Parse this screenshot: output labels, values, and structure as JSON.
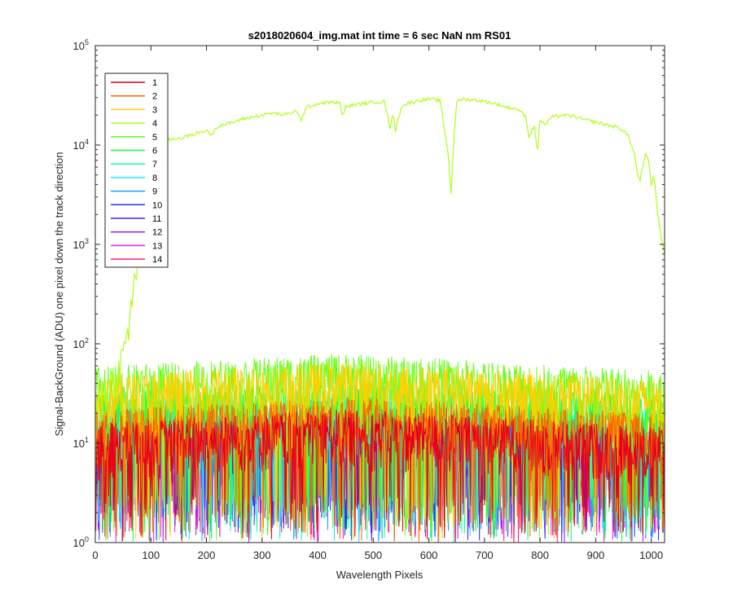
{
  "chart_data": {
    "type": "line",
    "title": "s2018020604_img.mat int time = 6 sec  NaN nm RS01",
    "xlabel": "Wavelength Pixels",
    "ylabel": "Signal-BackGround (ADU) one pixel down the track direction",
    "xlim": [
      0,
      1024
    ],
    "ylim": [
      1,
      100000
    ],
    "yscale": "log",
    "xticks": [
      "0",
      "100",
      "200",
      "300",
      "400",
      "500",
      "600",
      "700",
      "800",
      "900",
      "1000"
    ],
    "yticks": [
      {
        "base": "10",
        "exp": "0"
      },
      {
        "base": "10",
        "exp": "1"
      },
      {
        "base": "10",
        "exp": "2"
      },
      {
        "base": "10",
        "exp": "3"
      },
      {
        "base": "10",
        "exp": "4"
      },
      {
        "base": "10",
        "exp": "5"
      }
    ],
    "legend_position": "top-left",
    "series": [
      {
        "name": "1",
        "color": "#e6001a",
        "level": "noise",
        "typical": 15
      },
      {
        "name": "2",
        "color": "#ff6400",
        "level": "noise",
        "typical": 20
      },
      {
        "name": "3",
        "color": "#ffd000",
        "level": "noise",
        "typical": 45
      },
      {
        "name": "4",
        "color": "#b0ff1a",
        "level": "signal",
        "x": [
          0,
          20,
          40,
          55,
          65,
          75,
          80,
          90,
          100,
          110,
          120,
          140,
          160,
          180,
          200,
          210,
          215,
          220,
          230,
          250,
          260,
          280,
          300,
          320,
          340,
          360,
          370,
          380,
          390,
          400,
          420,
          440,
          445,
          450,
          460,
          480,
          500,
          520,
          530,
          535,
          540,
          550,
          560,
          570,
          580,
          600,
          620,
          635,
          640,
          645,
          650,
          660,
          680,
          700,
          720,
          740,
          760,
          775,
          780,
          790,
          795,
          800,
          810,
          820,
          840,
          860,
          880,
          900,
          920,
          940,
          950,
          960,
          970,
          975,
          980,
          985,
          990,
          995,
          1000,
          1005,
          1010,
          1015,
          1024
        ],
        "y": [
          25,
          35,
          50,
          100,
          250,
          600,
          1500,
          4000,
          8000,
          10000,
          11000,
          11500,
          12000,
          13000,
          14000,
          12500,
          14500,
          15500,
          16000,
          17000,
          18000,
          19000,
          20000,
          21000,
          20000,
          22000,
          18000,
          24000,
          25000,
          26000,
          27000,
          26500,
          19000,
          24000,
          25000,
          26000,
          27000,
          27500,
          15000,
          21000,
          14000,
          24000,
          26000,
          27000,
          28000,
          29000,
          28000,
          8000,
          3200,
          12000,
          27000,
          29000,
          28500,
          27500,
          26000,
          24000,
          23000,
          19000,
          12000,
          16000,
          8000,
          18000,
          16000,
          19000,
          20000,
          19500,
          18000,
          17000,
          16000,
          15000,
          14000,
          12000,
          8000,
          5000,
          4500,
          6000,
          8000,
          7000,
          4000,
          5000,
          2500,
          1500,
          800
        ]
      },
      {
        "name": "5",
        "color": "#6aff1a",
        "level": "noise",
        "typical": 55
      },
      {
        "name": "6",
        "color": "#1aff4a",
        "level": "noise",
        "typical": 30
      },
      {
        "name": "7",
        "color": "#1affa0",
        "level": "noise",
        "typical": 25
      },
      {
        "name": "8",
        "color": "#1ae6ff",
        "level": "noise",
        "typical": 20
      },
      {
        "name": "9",
        "color": "#1a9cff",
        "level": "noise",
        "typical": 15
      },
      {
        "name": "10",
        "color": "#1a3cff",
        "level": "noise",
        "typical": 14
      },
      {
        "name": "11",
        "color": "#501aff",
        "level": "noise",
        "typical": 13
      },
      {
        "name": "12",
        "color": "#a01aff",
        "level": "noise",
        "typical": 12
      },
      {
        "name": "13",
        "color": "#ff1aea",
        "level": "noise",
        "typical": 12
      },
      {
        "name": "14",
        "color": "#ff1a80",
        "level": "noise",
        "typical": 14
      }
    ]
  }
}
